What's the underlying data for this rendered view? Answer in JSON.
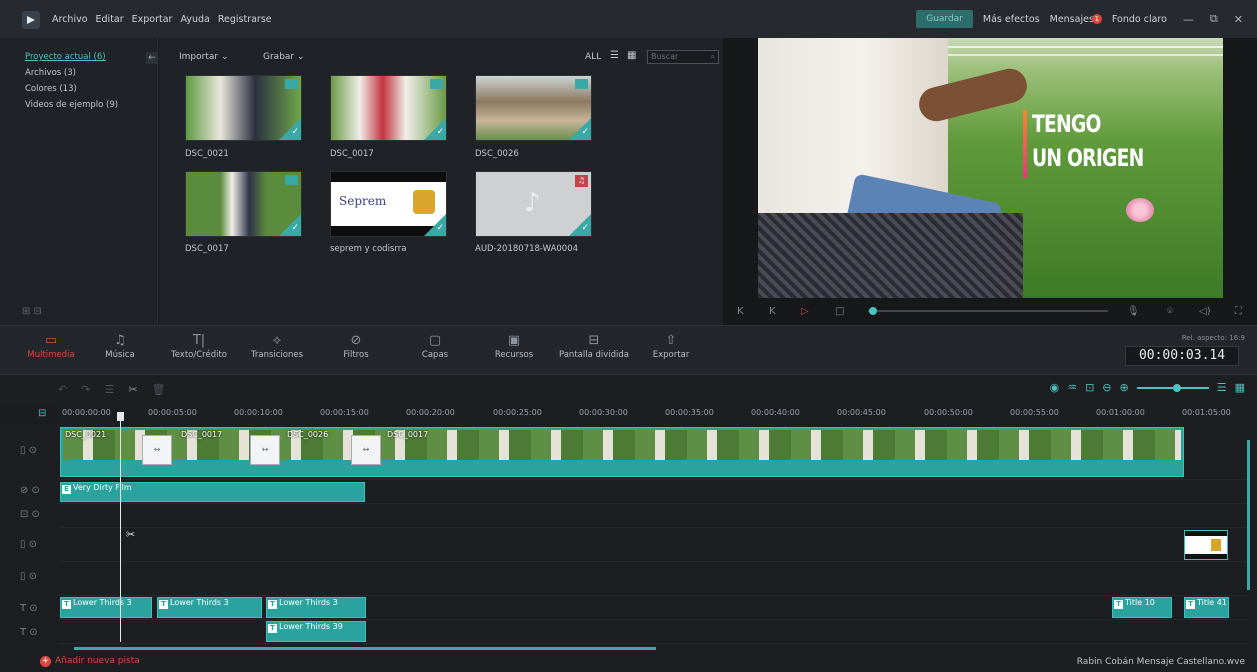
{
  "menubar": {
    "items": [
      "Archivo",
      "Editar",
      "Exportar",
      "Ayuda",
      "Registrarse"
    ],
    "save": "Guardar",
    "effects": "Más efectos",
    "messages": "Mensajes",
    "messages_badge": "1",
    "theme": "Fondo claro"
  },
  "sidebar": {
    "items": [
      "Proyecto actual (6)",
      "Archivos (3)",
      "Colores (13)",
      "Videos de ejemplo (9)"
    ]
  },
  "library": {
    "import": "Importar",
    "record": "Grabar",
    "filter_all": "ALL",
    "search_placeholder": "Buscar",
    "items": [
      {
        "label": "DSC_0021",
        "kind": "video"
      },
      {
        "label": "DSC_0017",
        "kind": "video"
      },
      {
        "label": "DSC_0026",
        "kind": "video"
      },
      {
        "label": "DSC_0017",
        "kind": "video"
      },
      {
        "label": "seprem y codisrra",
        "kind": "image"
      },
      {
        "label": "AUD-20180718-WA0004",
        "kind": "audio"
      }
    ],
    "logo_text": "Seprem"
  },
  "preview": {
    "title_line1": "TENGO",
    "title_line2": "UN ORIGEN"
  },
  "tabs": [
    {
      "label": "Multimedia",
      "icon": "folder-icon"
    },
    {
      "label": "Música",
      "icon": "music-icon"
    },
    {
      "label": "Texto/Crédito",
      "icon": "text-icon"
    },
    {
      "label": "Transiciones",
      "icon": "transition-icon"
    },
    {
      "label": "Filtros",
      "icon": "filter-icon"
    },
    {
      "label": "Capas",
      "icon": "overlay-icon"
    },
    {
      "label": "Recursos",
      "icon": "elements-icon"
    },
    {
      "label": "Pantalla dividida",
      "icon": "split-screen-icon"
    },
    {
      "label": "Exportar",
      "icon": "export-icon"
    }
  ],
  "aspect_ratio": "Rel. aspecto: 16:9",
  "timecode": "00:00:03.14",
  "ruler": [
    "00:00:00:00",
    "00:00:05:00",
    "00:00:10:00",
    "00:00:15:00",
    "00:00:20:00",
    "00:00:25:00",
    "00:00:30:00",
    "00:00:35:00",
    "00:00:40:00",
    "00:00:45:00",
    "00:00:50:00",
    "00:00:55:00",
    "00:01:00:00",
    "00:01:05:00"
  ],
  "tracks": {
    "video_labels": [
      "DSC_0021",
      "DSC_0017",
      "DSC_0026",
      "DSC_0017"
    ],
    "filter_clip": "Very Dirty Film",
    "text_clips": [
      "Lower Thirds 3",
      "Lower Thirds 3",
      "Lower Thirds 3",
      "Title 10",
      "Title 41"
    ],
    "text_clip_2": "Lower Thirds 39"
  },
  "footer": {
    "add_track": "Añadir nueva pista",
    "project": "Rabin Cobán Mensaje Castellano.wve"
  },
  "colors": {
    "accent": "#3aa9a6",
    "active_tab": "#e0453d"
  }
}
